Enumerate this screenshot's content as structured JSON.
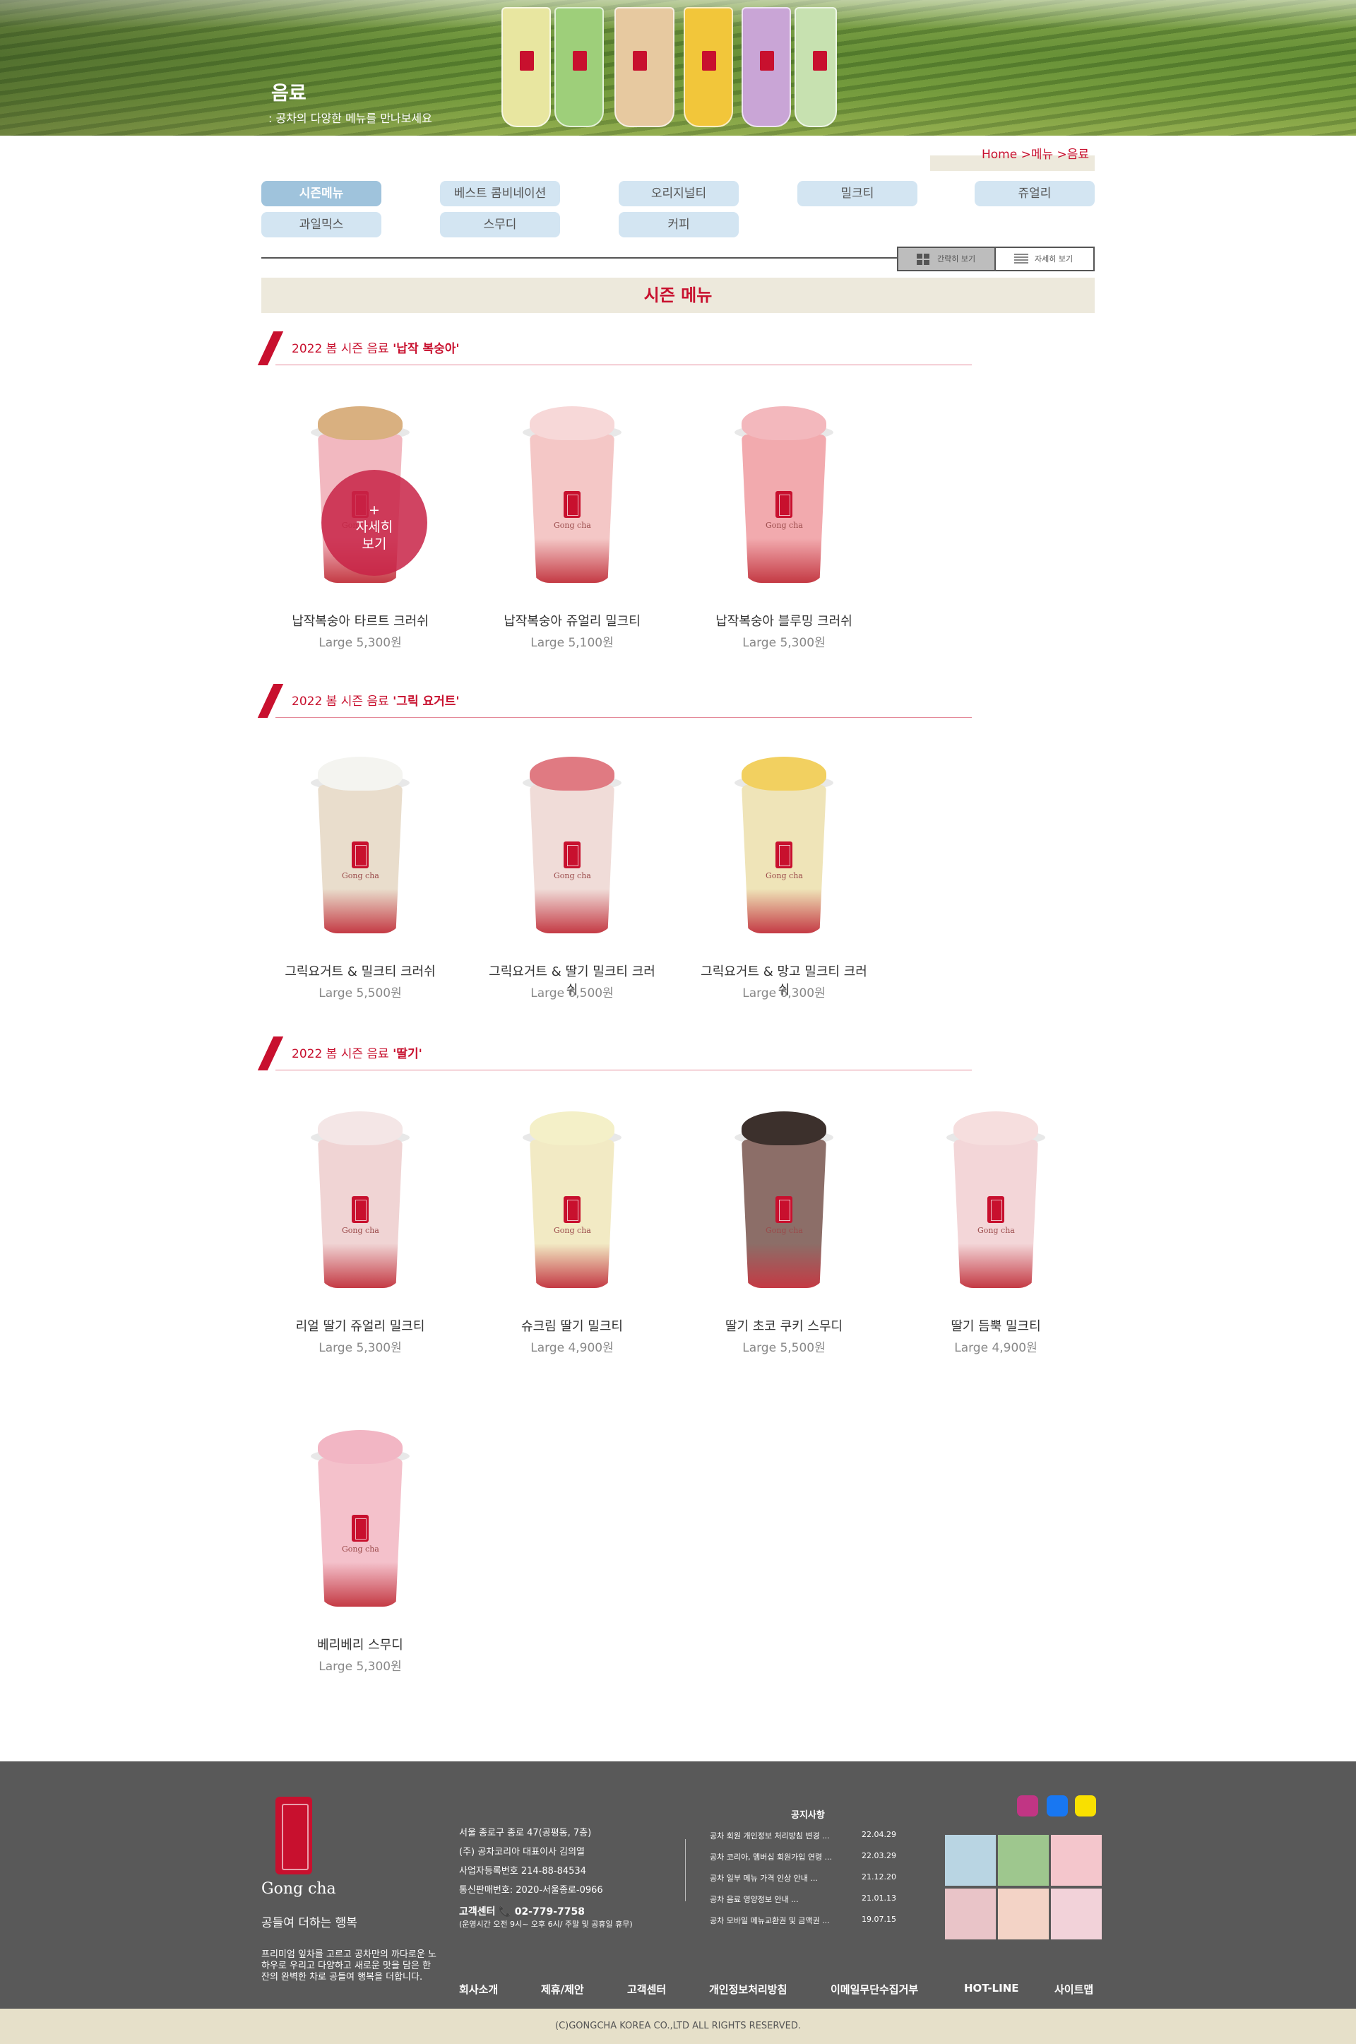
{
  "hero": {
    "title": "음료",
    "subtitle": ": 공차의 다양한 메뉴를 만나보세요"
  },
  "breadcrumb": "Home >메뉴 >음료",
  "tabs": [
    "시즌메뉴",
    "베스트 콤비네이션",
    "오리지널티",
    "밀크티",
    "쥬얼리",
    "과일믹스",
    "스무디",
    "커피"
  ],
  "view": {
    "simple": "간략히 보기",
    "detail": "자세히 보기"
  },
  "season_title": "시즌 메뉴",
  "detail_button": {
    "plus": "+",
    "line1": "자세히",
    "line2": "보기"
  },
  "sections": [
    {
      "prefix": "2022 봄 시즌 음료 ",
      "highlight": "'납작 복숭아'",
      "items": [
        {
          "name": "납작복숭아 타르트 크러쉬",
          "price": "Large 5,300원",
          "top": "#d9b080",
          "body": "#f2b8c0"
        },
        {
          "name": "납작복숭아 쥬얼리 밀크티",
          "price": "Large 5,100원",
          "top": "#f7d8d8",
          "body": "#f4c7c6"
        },
        {
          "name": "납작복숭아 블루밍 크러쉬",
          "price": "Large 5,300원",
          "top": "#f3b8bd",
          "body": "#f2aaae"
        }
      ]
    },
    {
      "prefix": "2022 봄 시즌 음료 ",
      "highlight": "'그릭 요거트'",
      "items": [
        {
          "name": "그릭요거트 & 밀크티 크러쉬",
          "price": "Large 5,500원",
          "top": "#f4f4f0",
          "body": "#e9ddcc"
        },
        {
          "name": "그릭요거트 & 딸기 밀크티 크러쉬",
          "price": "Large 6,500원",
          "top": "#e07a82",
          "body": "#f0dcd8"
        },
        {
          "name": "그릭요거트 & 망고 밀크티 크러쉬",
          "price": "Large 6,300원",
          "top": "#f2d060",
          "body": "#efe4b8"
        }
      ]
    },
    {
      "prefix": "2022 봄 시즌 음료 ",
      "highlight": "'딸기'",
      "items": [
        {
          "name": "리얼 딸기 쥬얼리 밀크티",
          "price": "Large 5,300원",
          "top": "#f4e6e6",
          "body": "#f0d4d4"
        },
        {
          "name": "슈크림 딸기 밀크티",
          "price": "Large 4,900원",
          "top": "#f4f0c8",
          "body": "#f2eac4"
        },
        {
          "name": "딸기 초코 쿠키 스무디",
          "price": "Large 5,500원",
          "top": "#3c302c",
          "body": "#8c6e68"
        },
        {
          "name": "딸기 듬뿍 밀크티",
          "price": "Large 4,900원",
          "top": "#f6dede",
          "body": "#f3d6d8"
        },
        {
          "name": "베리베리 스무디",
          "price": "Large 5,300원",
          "top": "#f2b6c4",
          "body": "#f4c1cb"
        }
      ]
    }
  ],
  "footer": {
    "brand": "Gong cha",
    "slogan": "공들여 더하는 행복",
    "desc": "프리미엄 잎차를 고르고 공차만의 까다로운 노하우로 우리고 다양하고 새로운 맛을 담은 한 잔의 완벽한 차로 공들여 행복을 더합니다.",
    "info": [
      "서울 종로구 종로 47(공평동, 7층)",
      "(주) 공차코리아 대표이사 김의열",
      "사업자등록번호 214-88-84534",
      "통신판매번호: 2020-서울종로-0966"
    ],
    "phone": "고객센터 📞 02-779-7758",
    "hours": "(운영시간 오전 9시~ 오후 6시/ 주말 및 공휴일 휴무)",
    "notice_title": "공지사항",
    "notices": [
      {
        "title": "공차 회원 개인정보 처리방침 변경 ...",
        "date": "22.04.29"
      },
      {
        "title": "공차 코리아, 멤버십 회원가입 연령 ...",
        "date": "22.03.29"
      },
      {
        "title": "공차 일부 메뉴 가격 인상 안내 ...",
        "date": "21.12.20"
      },
      {
        "title": "공차 음료 영양정보 안내 ...",
        "date": "21.01.13"
      },
      {
        "title": "공차 모바일 메뉴교환권 및 금액권 ...",
        "date": "19.07.15"
      }
    ],
    "links": [
      "회사소개",
      "제휴/제안",
      "고객센터",
      "개인정보처리방침",
      "이메일무단수집거부",
      "HOT-LINE",
      "사이트맵"
    ],
    "copyright": "(C)GONGCHA KOREA CO.,LTD ALL RIGHTS RESERVED.",
    "sns": [
      "instagram-icon",
      "facebook-icon",
      "kakao-talk-icon"
    ],
    "sns_colors": [
      "#c13584",
      "#1877f2",
      "#f9e000"
    ],
    "thumb_colors": [
      "#b9d5e3",
      "#9ec78e",
      "#f4c6cc",
      "#e9c4c8",
      "#f3d3c6",
      "#f2d2d9"
    ]
  },
  "colors": {
    "brand": "#c8102e",
    "tab_bg": "#d3e5f2",
    "tab_active": "#9fc3dc"
  }
}
